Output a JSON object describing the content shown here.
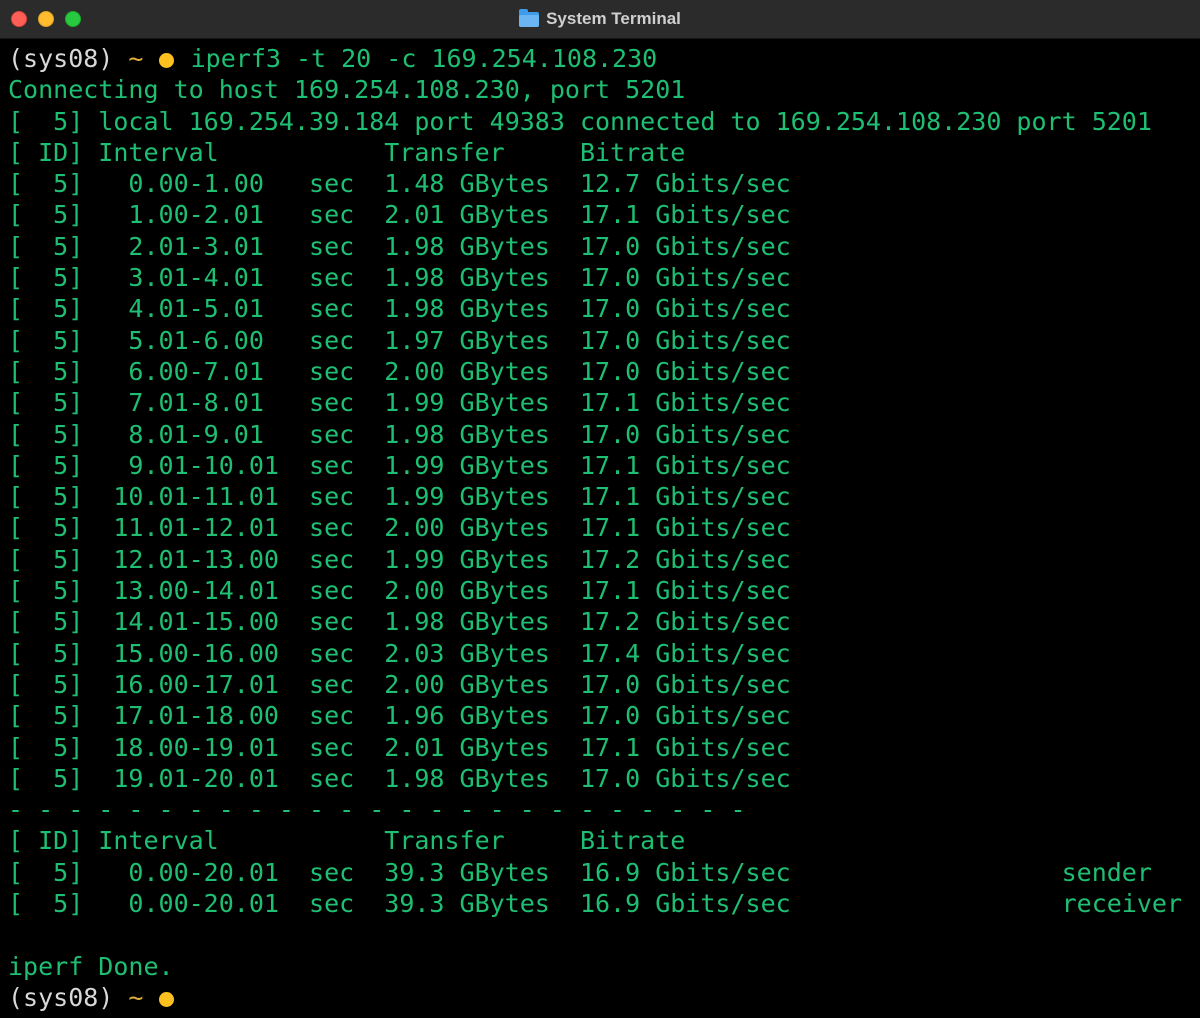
{
  "window": {
    "title": "System Terminal",
    "title_icon": "folder-icon"
  },
  "prompt": {
    "user": "(sys08)",
    "tilde": "~",
    "indicator": "yellow-dot"
  },
  "command": "iperf3 -t 20 -c 169.254.108.230",
  "output": {
    "connecting": "Connecting to host 169.254.108.230, port 5201",
    "local": "[  5] local 169.254.39.184 port 49383 connected to 169.254.108.230 port 5201",
    "header": "[ ID] Interval           Transfer     Bitrate",
    "rows": [
      "[  5]   0.00-1.00   sec  1.48 GBytes  12.7 Gbits/sec",
      "[  5]   1.00-2.01   sec  2.01 GBytes  17.1 Gbits/sec",
      "[  5]   2.01-3.01   sec  1.98 GBytes  17.0 Gbits/sec",
      "[  5]   3.01-4.01   sec  1.98 GBytes  17.0 Gbits/sec",
      "[  5]   4.01-5.01   sec  1.98 GBytes  17.0 Gbits/sec",
      "[  5]   5.01-6.00   sec  1.97 GBytes  17.0 Gbits/sec",
      "[  5]   6.00-7.01   sec  2.00 GBytes  17.0 Gbits/sec",
      "[  5]   7.01-8.01   sec  1.99 GBytes  17.1 Gbits/sec",
      "[  5]   8.01-9.01   sec  1.98 GBytes  17.0 Gbits/sec",
      "[  5]   9.01-10.01  sec  1.99 GBytes  17.1 Gbits/sec",
      "[  5]  10.01-11.01  sec  1.99 GBytes  17.1 Gbits/sec",
      "[  5]  11.01-12.01  sec  2.00 GBytes  17.1 Gbits/sec",
      "[  5]  12.01-13.00  sec  1.99 GBytes  17.2 Gbits/sec",
      "[  5]  13.00-14.01  sec  2.00 GBytes  17.1 Gbits/sec",
      "[  5]  14.01-15.00  sec  1.98 GBytes  17.2 Gbits/sec",
      "[  5]  15.00-16.00  sec  2.03 GBytes  17.4 Gbits/sec",
      "[  5]  16.00-17.01  sec  2.00 GBytes  17.0 Gbits/sec",
      "[  5]  17.01-18.00  sec  1.96 GBytes  17.0 Gbits/sec",
      "[  5]  18.00-19.01  sec  2.01 GBytes  17.1 Gbits/sec",
      "[  5]  19.01-20.01  sec  1.98 GBytes  17.0 Gbits/sec"
    ],
    "separator": "- - - - - - - - - - - - - - - - - - - - - - - - -",
    "summary_header": "[ ID] Interval           Transfer     Bitrate",
    "summary_rows": [
      "[  5]   0.00-20.01  sec  39.3 GBytes  16.9 Gbits/sec                  sender",
      "[  5]   0.00-20.01  sec  39.3 GBytes  16.9 Gbits/sec                  receiver"
    ],
    "done": "iperf Done."
  },
  "colors": {
    "text": "#1fbf73",
    "background": "#000000",
    "prompt_dot": "#fcc11e"
  }
}
